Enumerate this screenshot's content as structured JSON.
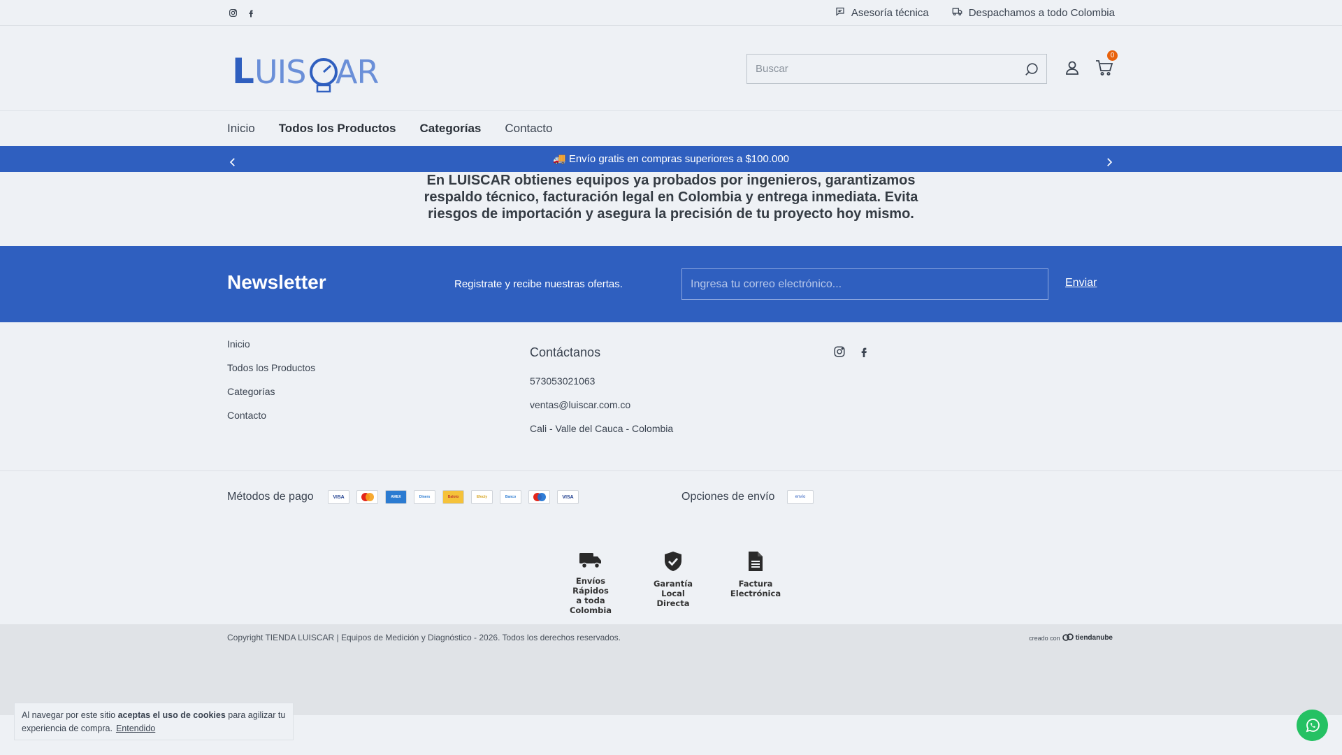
{
  "topbar": {
    "links": [
      {
        "label": "Asesoría técnica",
        "icon": "chat-icon"
      },
      {
        "label": "Despachamos a todo Colombia",
        "icon": "truck-icon"
      }
    ]
  },
  "header": {
    "logo_text": "LUISCAR",
    "search_placeholder": "Buscar",
    "cart_count": "0"
  },
  "nav": {
    "items": [
      "Inicio",
      "Todos los Productos",
      "Categorías",
      "Contacto"
    ]
  },
  "banner": {
    "text": "🚚 Envío gratis en compras superiores a $100.000"
  },
  "intro": {
    "text": "En LUISCAR obtienes equipos ya probados por ingenieros, garantizamos respaldo técnico, facturación legal en Colombia y entrega inmediata. Evita riesgos de importación y asegura la precisión de tu proyecto hoy mismo."
  },
  "newsletter": {
    "title": "Newsletter",
    "subtitle": "Registrate y recibe nuestras ofertas.",
    "placeholder": "Ingresa tu correo electrónico...",
    "button": "Enviar"
  },
  "footer": {
    "links": [
      "Inicio",
      "Todos los Productos",
      "Categorías",
      "Contacto"
    ],
    "contact_title": "Contáctanos",
    "phone": "573053021063",
    "email": "ventas@luiscar.com.co",
    "location": "Cali - Valle del Cauca - Colombia"
  },
  "payment": {
    "label": "Métodos de pago",
    "methods": [
      "VISA",
      "Mastercard",
      "AMEX",
      "Diners",
      "Baloto",
      "Efecty",
      "Banco",
      "Maestro",
      "VISA"
    ]
  },
  "shipping": {
    "label": "Opciones de envío",
    "provider": "envío"
  },
  "features": [
    {
      "label_1": "Envíos Rápidos",
      "label_2": "a toda Colombia",
      "icon": "truck-icon"
    },
    {
      "label_1": "Garantía Local",
      "label_2": "Directa",
      "icon": "shield-check-icon"
    },
    {
      "label_1": "Factura",
      "label_2": "Electrónica",
      "icon": "document-icon"
    }
  ],
  "copyright": {
    "text": "Copyright TIENDA LUISCAR | Equipos de Medición y Diagnóstico - 2026. Todos los derechos reservados.",
    "made_prefix": "creado con",
    "made_brand": "tiendanube"
  },
  "cookie": {
    "text_1": "Al navegar por este sitio ",
    "text_bold": "aceptas el uso de cookies",
    "text_2": " para agilizar tu experiencia de compra.",
    "accept": "Entendido"
  },
  "colors": {
    "brand_blue": "#2f5fbf",
    "badge_orange": "#e8620c",
    "whatsapp_green": "#25c163"
  }
}
